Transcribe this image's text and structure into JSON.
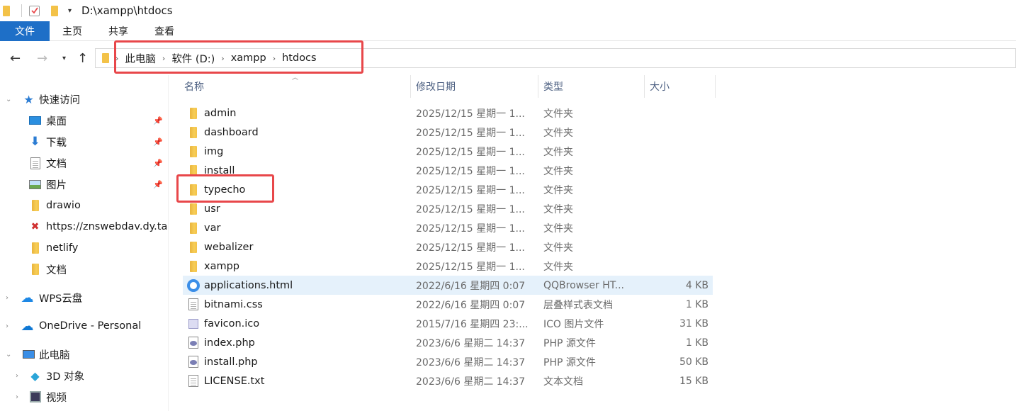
{
  "titlebar": {
    "path": "D:\\xampp\\htdocs"
  },
  "ribbon": {
    "file": "文件",
    "home": "主页",
    "share": "共享",
    "view": "查看"
  },
  "address": {
    "crumbs": [
      "此电脑",
      "软件 (D:)",
      "xampp",
      "htdocs"
    ]
  },
  "nav": {
    "quick_access": "快速访问",
    "desktop": "桌面",
    "downloads": "下载",
    "documents": "文档",
    "pictures": "图片",
    "drawio": "drawio",
    "webdav": "https://znswebdav.dy.ta",
    "netlify": "netlify",
    "documents2": "文档",
    "wps": "WPS云盘",
    "onedrive": "OneDrive - Personal",
    "this_pc": "此电脑",
    "objects3d": "3D 对象",
    "videos": "视频"
  },
  "columns": {
    "name": "名称",
    "date": "修改日期",
    "type": "类型",
    "size": "大小"
  },
  "files": [
    {
      "name": "admin",
      "date": "2025/12/15 星期一 1...",
      "type": "文件夹",
      "size": "",
      "icon": "folder-icon"
    },
    {
      "name": "dashboard",
      "date": "2025/12/15 星期一 1...",
      "type": "文件夹",
      "size": "",
      "icon": "folder-icon"
    },
    {
      "name": "img",
      "date": "2025/12/15 星期一 1...",
      "type": "文件夹",
      "size": "",
      "icon": "folder-icon"
    },
    {
      "name": "install",
      "date": "2025/12/15 星期一 1...",
      "type": "文件夹",
      "size": "",
      "icon": "folder-icon"
    },
    {
      "name": "typecho",
      "date": "2025/12/15 星期一 1...",
      "type": "文件夹",
      "size": "",
      "icon": "folder-icon"
    },
    {
      "name": "usr",
      "date": "2025/12/15 星期一 1...",
      "type": "文件夹",
      "size": "",
      "icon": "folder-icon"
    },
    {
      "name": "var",
      "date": "2025/12/15 星期一 1...",
      "type": "文件夹",
      "size": "",
      "icon": "folder-icon"
    },
    {
      "name": "webalizer",
      "date": "2025/12/15 星期一 1...",
      "type": "文件夹",
      "size": "",
      "icon": "folder-icon"
    },
    {
      "name": "xampp",
      "date": "2025/12/15 星期一 1...",
      "type": "文件夹",
      "size": "",
      "icon": "folder-icon"
    },
    {
      "name": "applications.html",
      "date": "2022/6/16 星期四 0:07",
      "type": "QQBrowser HT...",
      "size": "4 KB",
      "icon": "qqbrowser-icon"
    },
    {
      "name": "bitnami.css",
      "date": "2022/6/16 星期四 0:07",
      "type": "层叠样式表文档",
      "size": "1 KB",
      "icon": "css-file-icon"
    },
    {
      "name": "favicon.ico",
      "date": "2015/7/16 星期四 23:...",
      "type": "ICO 图片文件",
      "size": "31 KB",
      "icon": "image-file-icon"
    },
    {
      "name": "index.php",
      "date": "2023/6/6 星期二 14:37",
      "type": "PHP 源文件",
      "size": "1 KB",
      "icon": "php-file-icon"
    },
    {
      "name": "install.php",
      "date": "2023/6/6 星期二 14:37",
      "type": "PHP 源文件",
      "size": "50 KB",
      "icon": "php-file-icon"
    },
    {
      "name": "LICENSE.txt",
      "date": "2023/6/6 星期二 14:37",
      "type": "文本文档",
      "size": "15 KB",
      "icon": "text-file-icon"
    }
  ],
  "colors": {
    "accent": "#1e6fc7",
    "highlight": "#e8474a",
    "selection": "#e5f1fb",
    "folder": "#f3c248"
  }
}
